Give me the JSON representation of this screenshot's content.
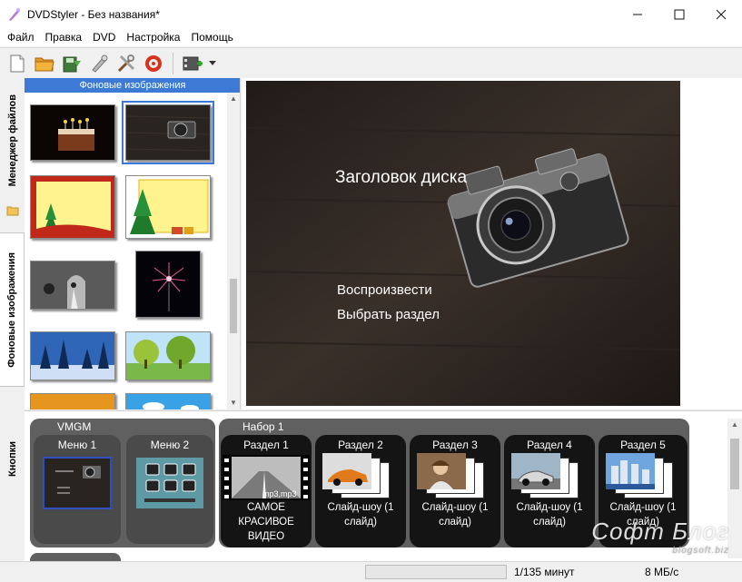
{
  "window": {
    "title": "DVDStyler - Без названия*",
    "minimize_icon": "minimize-icon",
    "maximize_icon": "maximize-icon",
    "close_icon": "close-icon"
  },
  "menu": [
    "Файл",
    "Правка",
    "DVD",
    "Настройка",
    "Помощь"
  ],
  "toolbar": {
    "icons": [
      "new-document-icon",
      "open-folder-icon",
      "save-icon",
      "burn-icon",
      "settings-icon",
      "dvd-disc-icon",
      "add-menu-icon",
      "dropdown-arrow-icon"
    ]
  },
  "vertical_tabs": [
    "Менеджер файлов",
    "Фоновые изображения",
    "Кнопки"
  ],
  "backgrounds_panel": {
    "header": "Фоновые изображения",
    "thumbnails": [
      "birthday-cake-thumbnail",
      "camera-thumbnail",
      "christmas-frame-thumbnail",
      "christmas-tree-thumbnail",
      "wedding-thumbnail",
      "fireworks-thumbnail",
      "winter-forest-thumbnail",
      "spring-park-thumbnail",
      "autumn-leaves-thumbnail",
      "blue-sky-thumbnail"
    ],
    "selected": "camera-thumbnail"
  },
  "preview": {
    "title": "Заголовок диска",
    "buttons": [
      "Воспроизвести",
      "Выбрать раздел"
    ]
  },
  "titleset": {
    "vmgm_label": "VMGM",
    "set_label": "Набор 1",
    "menus": [
      "Меню 1",
      "Меню 2"
    ],
    "sections": [
      {
        "label": "Раздел 1",
        "caption": "САМОЕ КРАСИВОЕ ВИДЕО",
        "badge": "mp3,mp3"
      },
      {
        "label": "Раздел 2",
        "caption": "Слайд-шоу (1 слайд)"
      },
      {
        "label": "Раздел 3",
        "caption": "Слайд-шоу (1 слайд)"
      },
      {
        "label": "Раздел 4",
        "caption": "Слайд-шоу (1 слайд)"
      },
      {
        "label": "Раздел 5",
        "caption": "Слайд-шоу (1 слайд)"
      }
    ]
  },
  "status": {
    "progress": 0.0,
    "minutes": "1/135 минут",
    "speed": "8 МБ/с"
  },
  "watermark": {
    "text": "Софт Блог",
    "url": "blogsoft.biz"
  },
  "colors": {
    "accent": "#3c7ad6",
    "group": "#606060",
    "node": "#141414"
  }
}
